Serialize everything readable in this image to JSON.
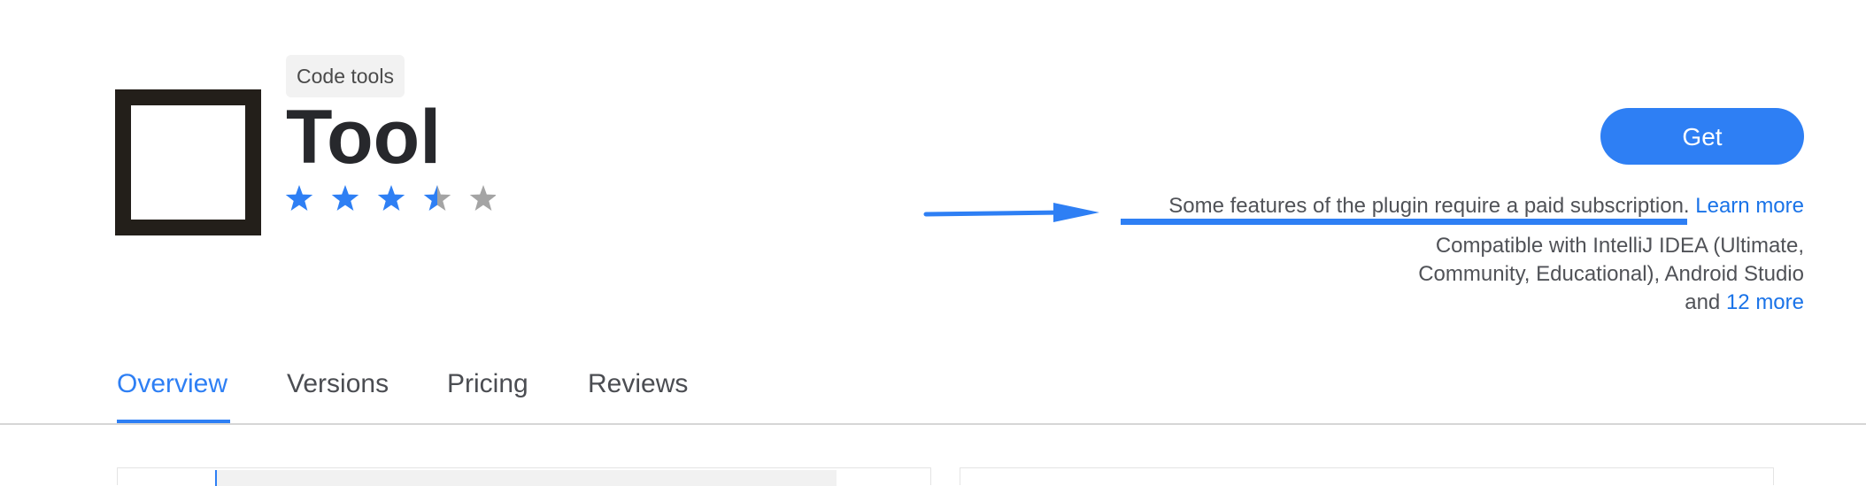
{
  "plugin": {
    "category": "Code tools",
    "name": "Tool",
    "rating": 3.5,
    "rating_max": 5,
    "star_colors": {
      "filled": "#2e7ff4",
      "empty": "#a4a4a4"
    }
  },
  "actions": {
    "get_label": "Get"
  },
  "subscription": {
    "notice": "Some features of the plugin require a paid subscription.",
    "learn_more": "Learn more"
  },
  "compatibility": {
    "line1": "Compatible with IntelliJ IDEA (Ultimate,",
    "line2": "Community, Educational), Android Studio",
    "line3_prefix": "and",
    "more_link": "12 more"
  },
  "tabs": [
    {
      "label": "Overview",
      "active": true
    },
    {
      "label": "Versions",
      "active": false
    },
    {
      "label": "Pricing",
      "active": false
    },
    {
      "label": "Reviews",
      "active": false
    }
  ],
  "colors": {
    "accent": "#2e7ff4",
    "link": "#1a73e8",
    "logo_border": "#231f1a"
  }
}
